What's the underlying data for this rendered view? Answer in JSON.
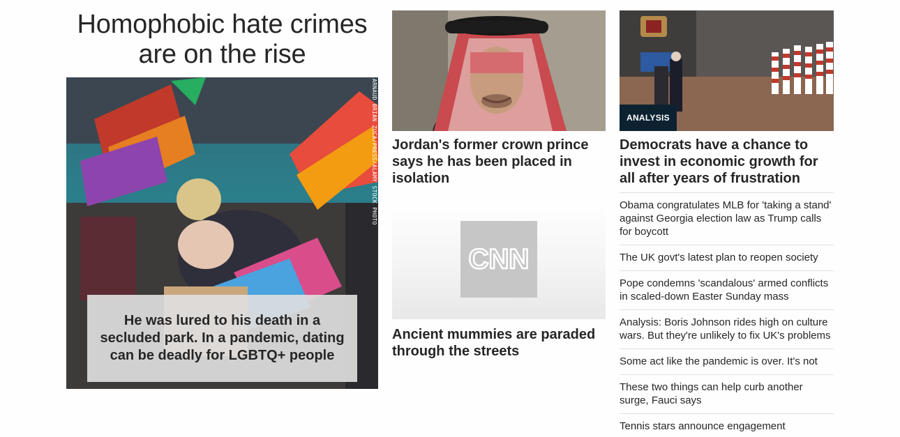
{
  "lead": {
    "headline": "Homophobic hate crimes are on the rise",
    "caption": "He was lured to his death in a secluded park. In a pandemic, dating can be deadly for LGBTQ+ people",
    "photo_credit": "ARNAUD BRIAN ZUCA/PRESS/ALAMY STOCK PHOTO"
  },
  "middle": {
    "story1_title": "Jordan's former crown prince says he has been placed in isolation",
    "story2_title": "Ancient mummies are paraded through the streets",
    "cnn_logo": "CNN"
  },
  "right": {
    "badge": "ANALYSIS",
    "main_title": "Democrats have a chance to invest in economic growth for all after years of frustration",
    "headlines": [
      "Obama congratulates MLB for 'taking a stand' against Georgia election law as Trump calls for boycott",
      "The UK govt's latest plan to reopen society",
      "Pope condemns 'scandalous' armed conflicts in scaled-down Easter Sunday mass",
      "Analysis: Boris Johnson rides high on culture wars. But they're unlikely to fix UK's problems",
      "Some act like the pandemic is over. It's not",
      "These two things can help curb another surge, Fauci says",
      "Tennis stars announce engagement"
    ]
  }
}
